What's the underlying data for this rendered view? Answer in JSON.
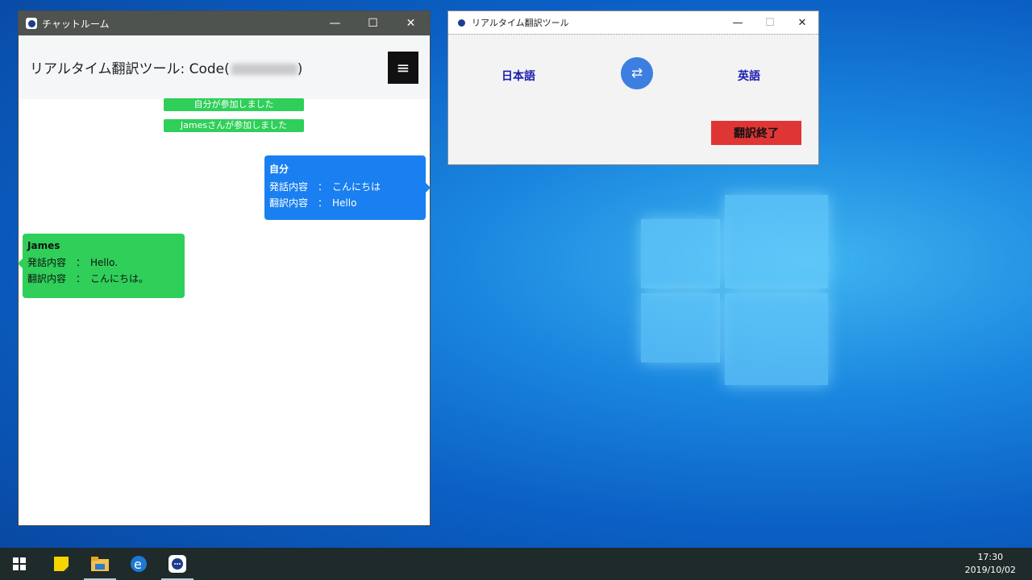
{
  "chat_window": {
    "title": "チャットルーム",
    "header_title": "リアルタイム翻訳ツール: Code(",
    "header_title_end": ")",
    "menu_icon": "≡",
    "system_messages": [
      "自分が参加しました",
      "Jamesさんが参加しました"
    ],
    "my_message": {
      "name": "自分",
      "speech_row": "発話内容　：　こんにちは",
      "translation_row": "翻訳内容　：　Hello"
    },
    "their_message": {
      "name": "James",
      "speech_row": "発話内容　：　Hello.",
      "translation_row": "翻訳内容　：　こんにちは。"
    }
  },
  "translate_window": {
    "title": "リアルタイム翻訳ツール",
    "source_lang": "日本語",
    "target_lang": "英語",
    "swap_icon": "⇄",
    "end_button": "翻訳終了"
  },
  "window_controls": {
    "minimize": "—",
    "maximize": "☐",
    "close": "✕"
  },
  "taskbar": {
    "time": "17:30",
    "date": "2019/10/02"
  }
}
